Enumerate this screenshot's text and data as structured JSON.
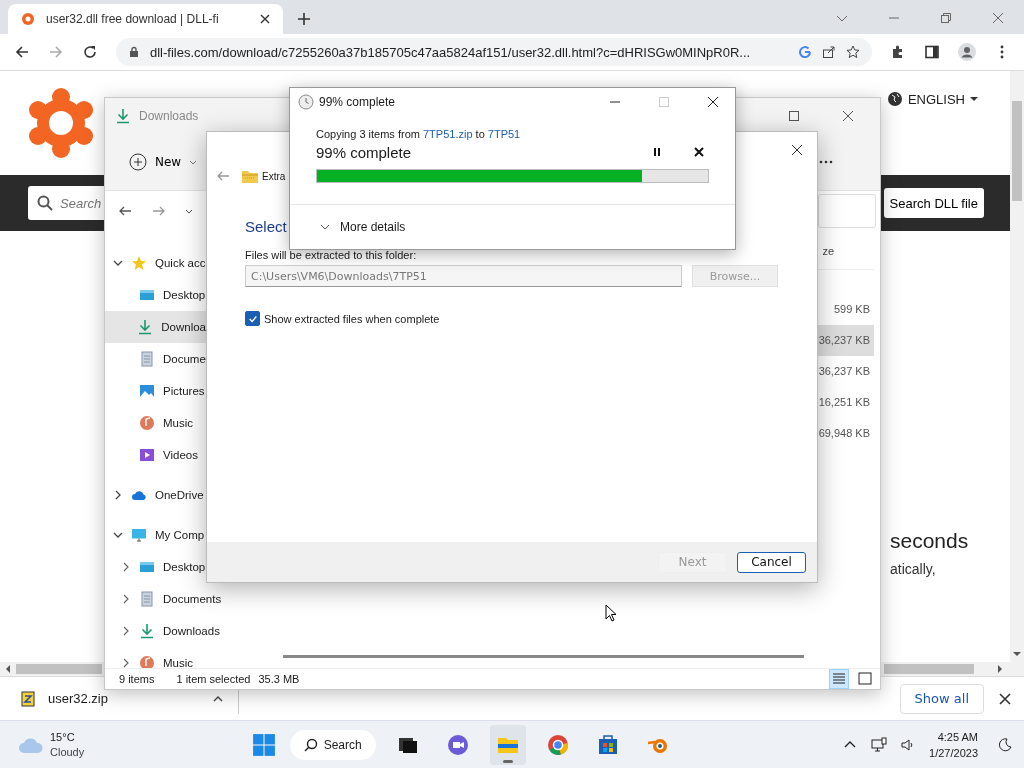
{
  "browser": {
    "tab": {
      "title": "user32.dll free download | DLL-fi"
    },
    "url": "dll-files.com/download/c7255260a37b185705c47aa5824af151/user32.dll.html?c=dHRISGw0MINpR0R...",
    "language": "ENGLISH",
    "search": {
      "placeholder": "Search"
    },
    "search_button": "Search DLL file",
    "page_text": [
      {
        "text": "seconds",
        "kind": "heading"
      },
      {
        "text": "atically,",
        "kind": "body"
      }
    ]
  },
  "download_shelf": {
    "file": "user32.zip",
    "show_all": "Show all"
  },
  "explorer": {
    "title": "Downloads",
    "new_button": "New",
    "sidebar": [
      {
        "label": "Quick acc",
        "kind": "star",
        "expanded": true,
        "children": [
          {
            "label": "Desktop",
            "kind": "desktop",
            "selected": false
          },
          {
            "label": "Downloa",
            "kind": "downloads",
            "selected": true
          },
          {
            "label": "Docume",
            "kind": "documents",
            "selected": false
          },
          {
            "label": "Pictures",
            "kind": "pictures",
            "selected": false
          },
          {
            "label": "Music",
            "kind": "music",
            "selected": false
          },
          {
            "label": "Videos",
            "kind": "videos",
            "selected": false
          }
        ]
      },
      {
        "label": "OneDrive",
        "kind": "cloud",
        "expanded": false
      },
      {
        "label": "My Comp",
        "kind": "computer",
        "expanded": true,
        "children": [
          {
            "label": "Desktop",
            "kind": "desktop",
            "selected": false,
            "expanded": false
          },
          {
            "label": "Documents",
            "kind": "documents",
            "selected": false,
            "expanded": false
          },
          {
            "label": "Downloads",
            "kind": "downloads",
            "selected": false,
            "expanded": false
          },
          {
            "label": "Music",
            "kind": "music",
            "selected": false,
            "expanded": false
          }
        ]
      }
    ],
    "column_header": "ze",
    "sizes": [
      {
        "text": "599 KB",
        "selected": false
      },
      {
        "text": "36,237 KB",
        "selected": true
      },
      {
        "text": "36,237 KB",
        "selected": false
      },
      {
        "text": "16,251 KB",
        "selected": false
      },
      {
        "text": "69,948 KB",
        "selected": false
      }
    ],
    "status": {
      "count": "9 items",
      "selection": "1 item selected",
      "size": "35.3 MB"
    },
    "views": [
      {
        "kind": "details",
        "selected": true
      },
      {
        "kind": "tiles",
        "selected": false
      }
    ]
  },
  "extract": {
    "title": "Extra",
    "heading": "Select",
    "folder_label": "Files will be extracted to this folder:",
    "path": "C:\\Users\\VM6\\Downloads\\7TP51",
    "browse": {
      "label": "Browse...",
      "disabled": true
    },
    "show_files": {
      "label": "Show extracted files when complete",
      "checked": true
    },
    "next": {
      "label": "Next",
      "disabled": true
    },
    "cancel": "Cancel"
  },
  "progress": {
    "title": "99% complete",
    "message": {
      "prefix": "Copying 3 items from",
      "source": "7TP51.zip",
      "middle": "to",
      "destination": "7TP51"
    },
    "status": "99% complete",
    "level": 0.83,
    "more_details": "More details"
  },
  "taskbar": {
    "weather": {
      "temperature": "15°C",
      "condition": "Cloudy"
    },
    "search": "Search",
    "apps": [
      {
        "kind": "taskview",
        "active": false
      },
      {
        "kind": "chat",
        "active": false
      },
      {
        "kind": "explorer",
        "active": true
      },
      {
        "kind": "chrome",
        "active": false
      },
      {
        "kind": "store",
        "active": false
      },
      {
        "kind": "blender",
        "active": false
      }
    ],
    "time": "4:25 AM",
    "date": "1/27/2023"
  }
}
